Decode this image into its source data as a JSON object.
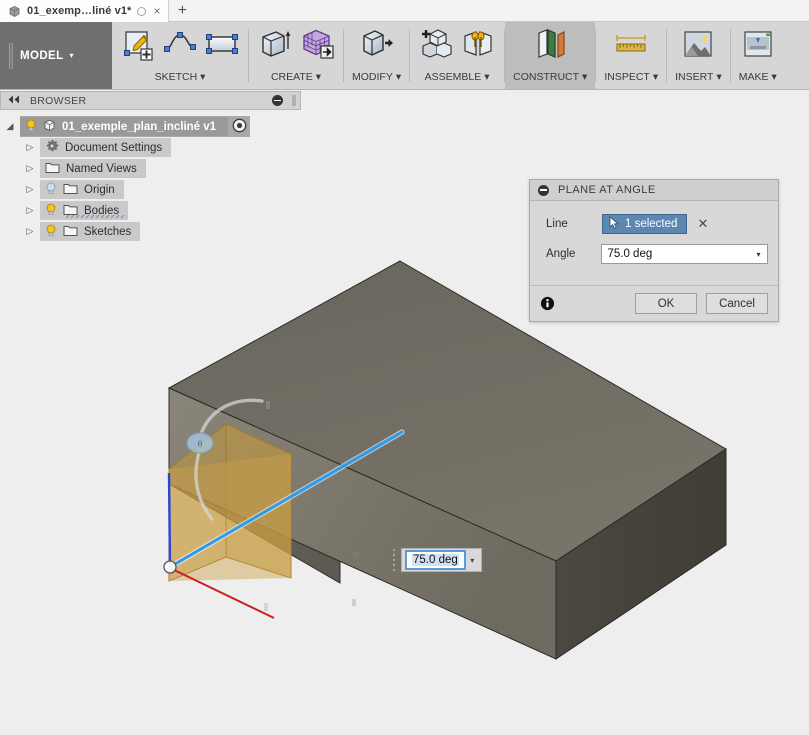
{
  "tab": {
    "doc_icon": "cube-icon",
    "title": "01_exemp…liné v1*",
    "saved_indicator": "unsaved-circle-icon",
    "close_label": "×",
    "new_tab_label": "+"
  },
  "ribbon": {
    "workspace": {
      "label": "MODEL",
      "caret": "▾"
    },
    "panels": [
      {
        "id": "sketch",
        "label": "SKETCH",
        "caret": "▾",
        "selected": false,
        "tools": [
          "create-sketch-icon",
          "spline-icon",
          "rectangle-icon"
        ]
      },
      {
        "id": "create",
        "label": "CREATE",
        "caret": "▾",
        "selected": false,
        "tools": [
          "extrude-icon",
          "box-primitive-icon"
        ]
      },
      {
        "id": "modify",
        "label": "MODIFY",
        "caret": "▾",
        "selected": false,
        "tools": [
          "press-pull-icon"
        ]
      },
      {
        "id": "assemble",
        "label": "ASSEMBLE",
        "caret": "▾",
        "selected": false,
        "tools": [
          "new-component-icon",
          "joint-icon"
        ]
      },
      {
        "id": "construct",
        "label": "CONSTRUCT",
        "caret": "▾",
        "selected": true,
        "tools": [
          "plane-at-angle-icon"
        ]
      },
      {
        "id": "inspect",
        "label": "INSPECT",
        "caret": "▾",
        "selected": false,
        "tools": [
          "measure-icon"
        ]
      },
      {
        "id": "insert",
        "label": "INSERT",
        "caret": "▾",
        "selected": false,
        "tools": [
          "insert-image-icon"
        ]
      },
      {
        "id": "make",
        "label": "MAKE",
        "caret": "▾",
        "selected": false,
        "tools": [
          "3d-print-icon"
        ]
      }
    ]
  },
  "browser": {
    "header": {
      "title": "BROWSER",
      "collapse_icon": "collapse-left-icon",
      "minimize_icon": "minimize-icon"
    },
    "root": {
      "label": "01_exemple_plan_incliné v1",
      "bulb": "lightbulb-on-icon",
      "icon": "component-icon",
      "badge": "target-icon",
      "expander": "◢"
    },
    "items": [
      {
        "label": "Document Settings",
        "icon": "gear-icon",
        "bulb": null,
        "expander": "▷",
        "underlined": false
      },
      {
        "label": "Named Views",
        "icon": "folder-icon",
        "bulb": null,
        "expander": "▷",
        "underlined": false
      },
      {
        "label": "Origin",
        "icon": "folder-icon",
        "bulb": "lightbulb-off-icon",
        "expander": "▷",
        "underlined": false
      },
      {
        "label": "Bodies",
        "icon": "folder-icon",
        "bulb": "lightbulb-on-icon",
        "expander": "▷",
        "underlined": true
      },
      {
        "label": "Sketches",
        "icon": "folder-icon",
        "bulb": "lightbulb-on-icon",
        "expander": "▷",
        "underlined": false
      }
    ]
  },
  "dialog": {
    "title": "PLANE AT ANGLE",
    "collapse_icon": "collapse-minus-icon",
    "line_label": "Line",
    "line_value": "1 selected",
    "line_cursor_icon": "select-cursor-icon",
    "clear_selection_label": "✕",
    "angle_label": "Angle",
    "angle_value": "75.0 deg",
    "angle_dropdown": "▾",
    "info_icon": "info-icon",
    "ok_label": "OK",
    "cancel_label": "Cancel"
  },
  "canvas_field": {
    "value": "75.0 deg",
    "dropdown": "▾",
    "grip_icon": "drag-grip-icon"
  },
  "colors": {
    "accent_blue": "#2a9cf0",
    "selection_blue": "#5b87b0",
    "plane_amber": "#c49a3e",
    "body_top": "#6d6a62",
    "body_front": "#77736a",
    "body_right": "#45423b",
    "canvas_bg": "#eeeeee",
    "ribbon_bg": "#d6d6d6",
    "workspace_bg": "#6f6f6f",
    "axis_blue": "#2b43d6",
    "axis_red": "#cf2020"
  },
  "viewport": {
    "model_name": "inclined-plane-block",
    "construction_plane_angle_deg": 75.0,
    "rotation_handle": "rotation-arc-handle"
  }
}
